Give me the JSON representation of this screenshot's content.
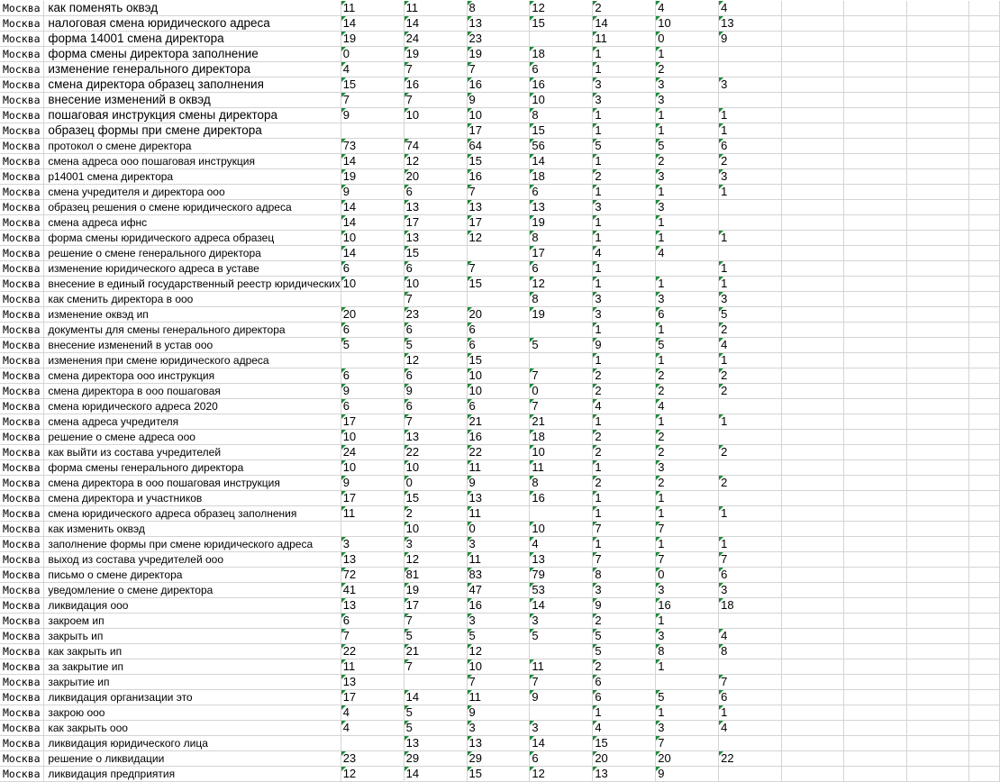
{
  "sheet": {
    "rows": [
      {
        "city": "Москва",
        "kw": "как поменять оквэд",
        "v": [
          "11",
          "11",
          "8",
          "12",
          "2",
          "4",
          "4"
        ]
      },
      {
        "city": "Москва",
        "kw": "налоговая смена юридического адреса",
        "v": [
          "14",
          "14",
          "13",
          "15",
          "14",
          "10",
          "13"
        ]
      },
      {
        "city": "Москва",
        "kw": "форма 14001 смена директора",
        "v": [
          "19",
          "24",
          "23",
          "",
          "11",
          "0",
          "9"
        ]
      },
      {
        "city": "Москва",
        "kw": "форма смены директора заполнение",
        "v": [
          "0",
          "19",
          "19",
          "18",
          "1",
          "1",
          ""
        ]
      },
      {
        "city": "Москва",
        "kw": "изменение генерального директора",
        "v": [
          "4",
          "7",
          "7",
          "6",
          "1",
          "2",
          ""
        ]
      },
      {
        "city": "Москва",
        "kw": "смена директора образец заполнения",
        "v": [
          "15",
          "16",
          "16",
          "16",
          "3",
          "3",
          "3"
        ]
      },
      {
        "city": "Москва",
        "kw": "внесение изменений в оквэд",
        "v": [
          "7",
          "7",
          "9",
          "10",
          "3",
          "3",
          ""
        ]
      },
      {
        "city": "Москва",
        "kw": "пошаговая инструкция смены директора",
        "v": [
          "9",
          "10",
          "10",
          "8",
          "1",
          "1",
          "1"
        ]
      },
      {
        "city": "Москва",
        "kw": "образец формы при смене директора",
        "v": [
          "",
          "",
          "17",
          "15",
          "1",
          "1",
          "1"
        ]
      },
      {
        "city": "Москва",
        "kw": "протокол о смене директора",
        "v": [
          "73",
          "74",
          "64",
          "56",
          "5",
          "5",
          "6"
        ]
      },
      {
        "city": "Москва",
        "kw": "смена адреса ооо пошаговая инструкция",
        "v": [
          "14",
          "12",
          "15",
          "14",
          "1",
          "2",
          "2"
        ]
      },
      {
        "city": "Москва",
        "kw": "р14001 смена директора",
        "v": [
          "19",
          "20",
          "16",
          "18",
          "2",
          "3",
          "3"
        ]
      },
      {
        "city": "Москва",
        "kw": "смена учредителя и директора ооо",
        "v": [
          "9",
          "6",
          "7",
          "6",
          "1",
          "1",
          "1"
        ]
      },
      {
        "city": "Москва",
        "kw": "образец решения о смене юридического адреса",
        "v": [
          "14",
          "13",
          "13",
          "13",
          "3",
          "3",
          ""
        ]
      },
      {
        "city": "Москва",
        "kw": "смена адреса ифнс",
        "v": [
          "14",
          "17",
          "17",
          "19",
          "1",
          "1",
          ""
        ]
      },
      {
        "city": "Москва",
        "kw": "форма смены юридического адреса образец",
        "v": [
          "10",
          "13",
          "12",
          "8",
          "1",
          "1",
          "1"
        ]
      },
      {
        "city": "Москва",
        "kw": "решение о смене генерального директора",
        "v": [
          "14",
          "15",
          "",
          "17",
          "4",
          "4",
          ""
        ]
      },
      {
        "city": "Москва",
        "kw": "изменение юридического адреса в уставе",
        "v": [
          "6",
          "6",
          "7",
          "6",
          "1",
          "",
          "1"
        ]
      },
      {
        "city": "Москва",
        "kw": "внесение в единый государственный реестр юридических",
        "v": [
          "10",
          "10",
          "15",
          "12",
          "1",
          "1",
          "1"
        ]
      },
      {
        "city": "Москва",
        "kw": "как сменить директора в ооо",
        "v": [
          "",
          "7",
          "",
          "8",
          "3",
          "3",
          "3"
        ]
      },
      {
        "city": "Москва",
        "kw": "изменение оквэд ип",
        "v": [
          "20",
          "23",
          "20",
          "19",
          "3",
          "6",
          "5"
        ]
      },
      {
        "city": "Москва",
        "kw": "документы для смены генерального директора",
        "v": [
          "6",
          "6",
          "6",
          "",
          "1",
          "1",
          "2"
        ]
      },
      {
        "city": "Москва",
        "kw": "внесение изменений в устав ооо",
        "v": [
          "5",
          "5",
          "6",
          "5",
          "9",
          "5",
          "4"
        ]
      },
      {
        "city": "Москва",
        "kw": "изменения при смене юридического адреса",
        "v": [
          "",
          "12",
          "15",
          "",
          "1",
          "1",
          "1"
        ]
      },
      {
        "city": "Москва",
        "kw": "смена директора ооо инструкция",
        "v": [
          "6",
          "6",
          "10",
          "7",
          "2",
          "2",
          "2"
        ]
      },
      {
        "city": "Москва",
        "kw": "смена директора в ооо пошаговая",
        "v": [
          "9",
          "9",
          "10",
          "0",
          "2",
          "2",
          "2"
        ]
      },
      {
        "city": "Москва",
        "kw": "смена юридического адреса 2020",
        "v": [
          "6",
          "6",
          "6",
          "7",
          "4",
          "4",
          ""
        ]
      },
      {
        "city": "Москва",
        "kw": "смена адреса учредителя",
        "v": [
          "17",
          "7",
          "21",
          "21",
          "1",
          "1",
          "1"
        ]
      },
      {
        "city": "Москва",
        "kw": "решение о смене адреса ооо",
        "v": [
          "10",
          "13",
          "16",
          "18",
          "2",
          "2",
          ""
        ]
      },
      {
        "city": "Москва",
        "kw": "как выйти из состава учредителей",
        "v": [
          "24",
          "22",
          "22",
          "10",
          "2",
          "2",
          "2"
        ]
      },
      {
        "city": "Москва",
        "kw": "форма смены генерального директора",
        "v": [
          "10",
          "10",
          "11",
          "11",
          "1",
          "3",
          ""
        ]
      },
      {
        "city": "Москва",
        "kw": "смена директора в ооо пошаговая инструкция",
        "v": [
          "9",
          "0",
          "9",
          "8",
          "2",
          "2",
          "2"
        ]
      },
      {
        "city": "Москва",
        "kw": "смена директора и участников",
        "v": [
          "17",
          "15",
          "13",
          "16",
          "1",
          "1",
          ""
        ]
      },
      {
        "city": "Москва",
        "kw": "смена юридического адреса образец заполнения",
        "v": [
          "11",
          "2",
          "11",
          "",
          "1",
          "1",
          "1"
        ]
      },
      {
        "city": "Москва",
        "kw": "как изменить оквэд",
        "v": [
          "",
          "10",
          "0",
          "10",
          "7",
          "7",
          ""
        ]
      },
      {
        "city": "Москва",
        "kw": "заполнение формы при смене юридического адреса",
        "v": [
          "3",
          "3",
          "3",
          "4",
          "1",
          "1",
          "1"
        ]
      },
      {
        "city": "Москва",
        "kw": "выход из состава учредителей ооо",
        "v": [
          "13",
          "12",
          "11",
          "13",
          "7",
          "7",
          "7"
        ]
      },
      {
        "city": "Москва",
        "kw": "письмо о смене директора",
        "v": [
          "72",
          "81",
          "83",
          "79",
          "8",
          "0",
          "6"
        ]
      },
      {
        "city": "Москва",
        "kw": "уведомление о смене директора",
        "v": [
          "41",
          "19",
          "47",
          "53",
          "3",
          "3",
          "3"
        ]
      },
      {
        "city": "Москва",
        "kw": "ликвидация ооо",
        "v": [
          "13",
          "17",
          "16",
          "14",
          "9",
          "16",
          "18"
        ]
      },
      {
        "city": "Москва",
        "kw": "закроем ип",
        "v": [
          "6",
          "7",
          "3",
          "3",
          "2",
          "1",
          ""
        ]
      },
      {
        "city": "Москва",
        "kw": "закрыть ип",
        "v": [
          "7",
          "5",
          "5",
          "5",
          "5",
          "3",
          "4"
        ]
      },
      {
        "city": "Москва",
        "kw": "как закрыть ип",
        "v": [
          "22",
          "21",
          "12",
          "",
          "5",
          "8",
          "8"
        ]
      },
      {
        "city": "Москва",
        "kw": "за закрытие ип",
        "v": [
          "11",
          "7",
          "10",
          "11",
          "2",
          "1",
          ""
        ]
      },
      {
        "city": "Москва",
        "kw": "закрытие ип",
        "v": [
          "13",
          "",
          "7",
          "7",
          "6",
          "",
          "7"
        ]
      },
      {
        "city": "Москва",
        "kw": "ликвидация организации это",
        "v": [
          "17",
          "14",
          "11",
          "9",
          "6",
          "5",
          "6"
        ]
      },
      {
        "city": "Москва",
        "kw": "закрою ооо",
        "v": [
          "4",
          "5",
          "9",
          "",
          "1",
          "1",
          "1"
        ]
      },
      {
        "city": "Москва",
        "kw": "как закрыть ооо",
        "v": [
          "4",
          "5",
          "3",
          "3",
          "4",
          "3",
          "4"
        ]
      },
      {
        "city": "Москва",
        "kw": "ликвидация юридического лица",
        "v": [
          "",
          "13",
          "13",
          "14",
          "15",
          "7",
          ""
        ]
      },
      {
        "city": "Москва",
        "kw": "решение о ликвидации",
        "v": [
          "23",
          "29",
          "29",
          "6",
          "20",
          "20",
          "22"
        ]
      },
      {
        "city": "Москва",
        "kw": "ликвидация предприятия",
        "v": [
          "12",
          "14",
          "15",
          "12",
          "13",
          "9",
          ""
        ]
      }
    ]
  }
}
